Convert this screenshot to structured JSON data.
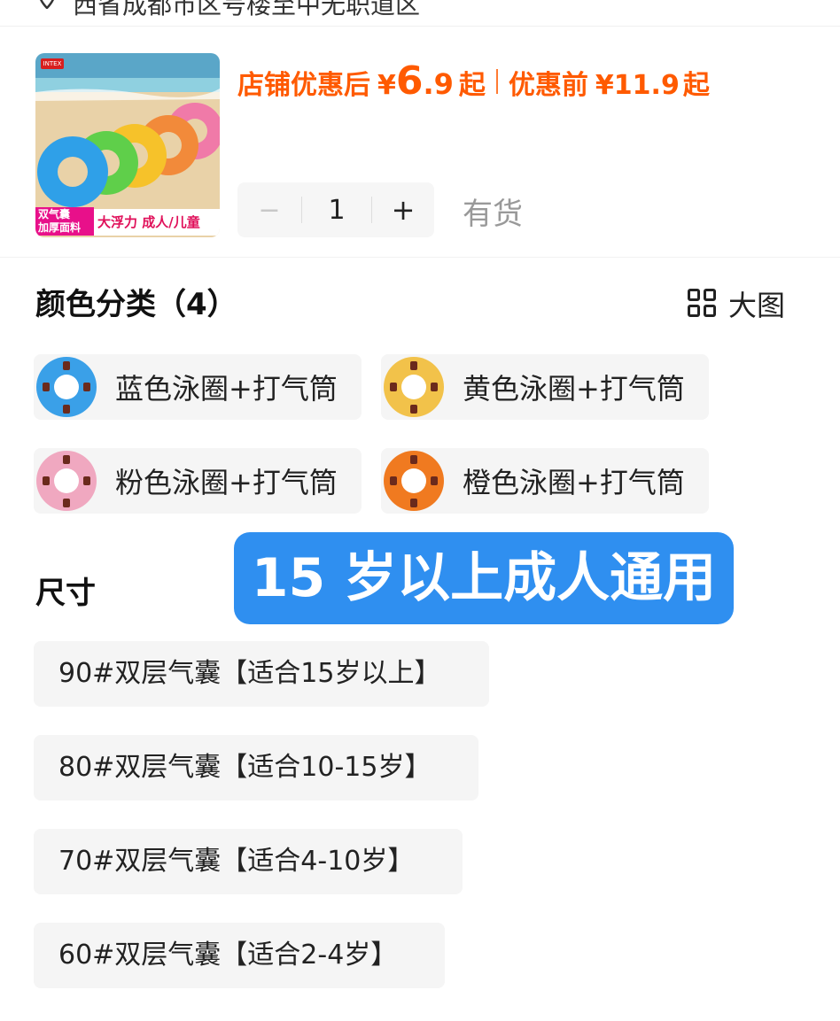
{
  "top": {
    "address": "西省成都市区号楼至中无职道区"
  },
  "product": {
    "badge_line1": "双气囊",
    "badge_line2": "加厚面料",
    "badge_right": "大浮力 成人/儿童",
    "brand": "INTEX"
  },
  "price": {
    "after_label": "店铺优惠后",
    "yen": "¥",
    "after_int": "6",
    "after_dec": ".9",
    "after_suffix": "起",
    "before_label": "优惠前",
    "before_value": "¥11.9",
    "before_suffix": "起",
    "color": "#ff5a00"
  },
  "stepper": {
    "minus": "−",
    "quantity": "1",
    "plus": "+"
  },
  "stock_status": "有货",
  "color_section": {
    "title": "颜色分类（4）",
    "big_view_label": "大图",
    "items": [
      {
        "label": "蓝色泳圈+打气筒",
        "color": "#3aa0e8"
      },
      {
        "label": "黄色泳圈+打气筒",
        "color": "#f2c24a"
      },
      {
        "label": "粉色泳圈+打气筒",
        "color": "#f0a8c0"
      },
      {
        "label": "橙色泳圈+打气筒",
        "color": "#f07a20"
      }
    ]
  },
  "size_section": {
    "title": "尺寸",
    "items": [
      {
        "label": "90#双层气囊【适合15岁以上】"
      },
      {
        "label": "80#双层气囊【适合10-15岁】"
      },
      {
        "label": "70#双层气囊【适合4-10岁】"
      },
      {
        "label": "60#双层气囊【适合2-4岁】"
      }
    ]
  },
  "overlay": {
    "text": "15 岁以上成人通用",
    "color": "#2f8ff0"
  }
}
